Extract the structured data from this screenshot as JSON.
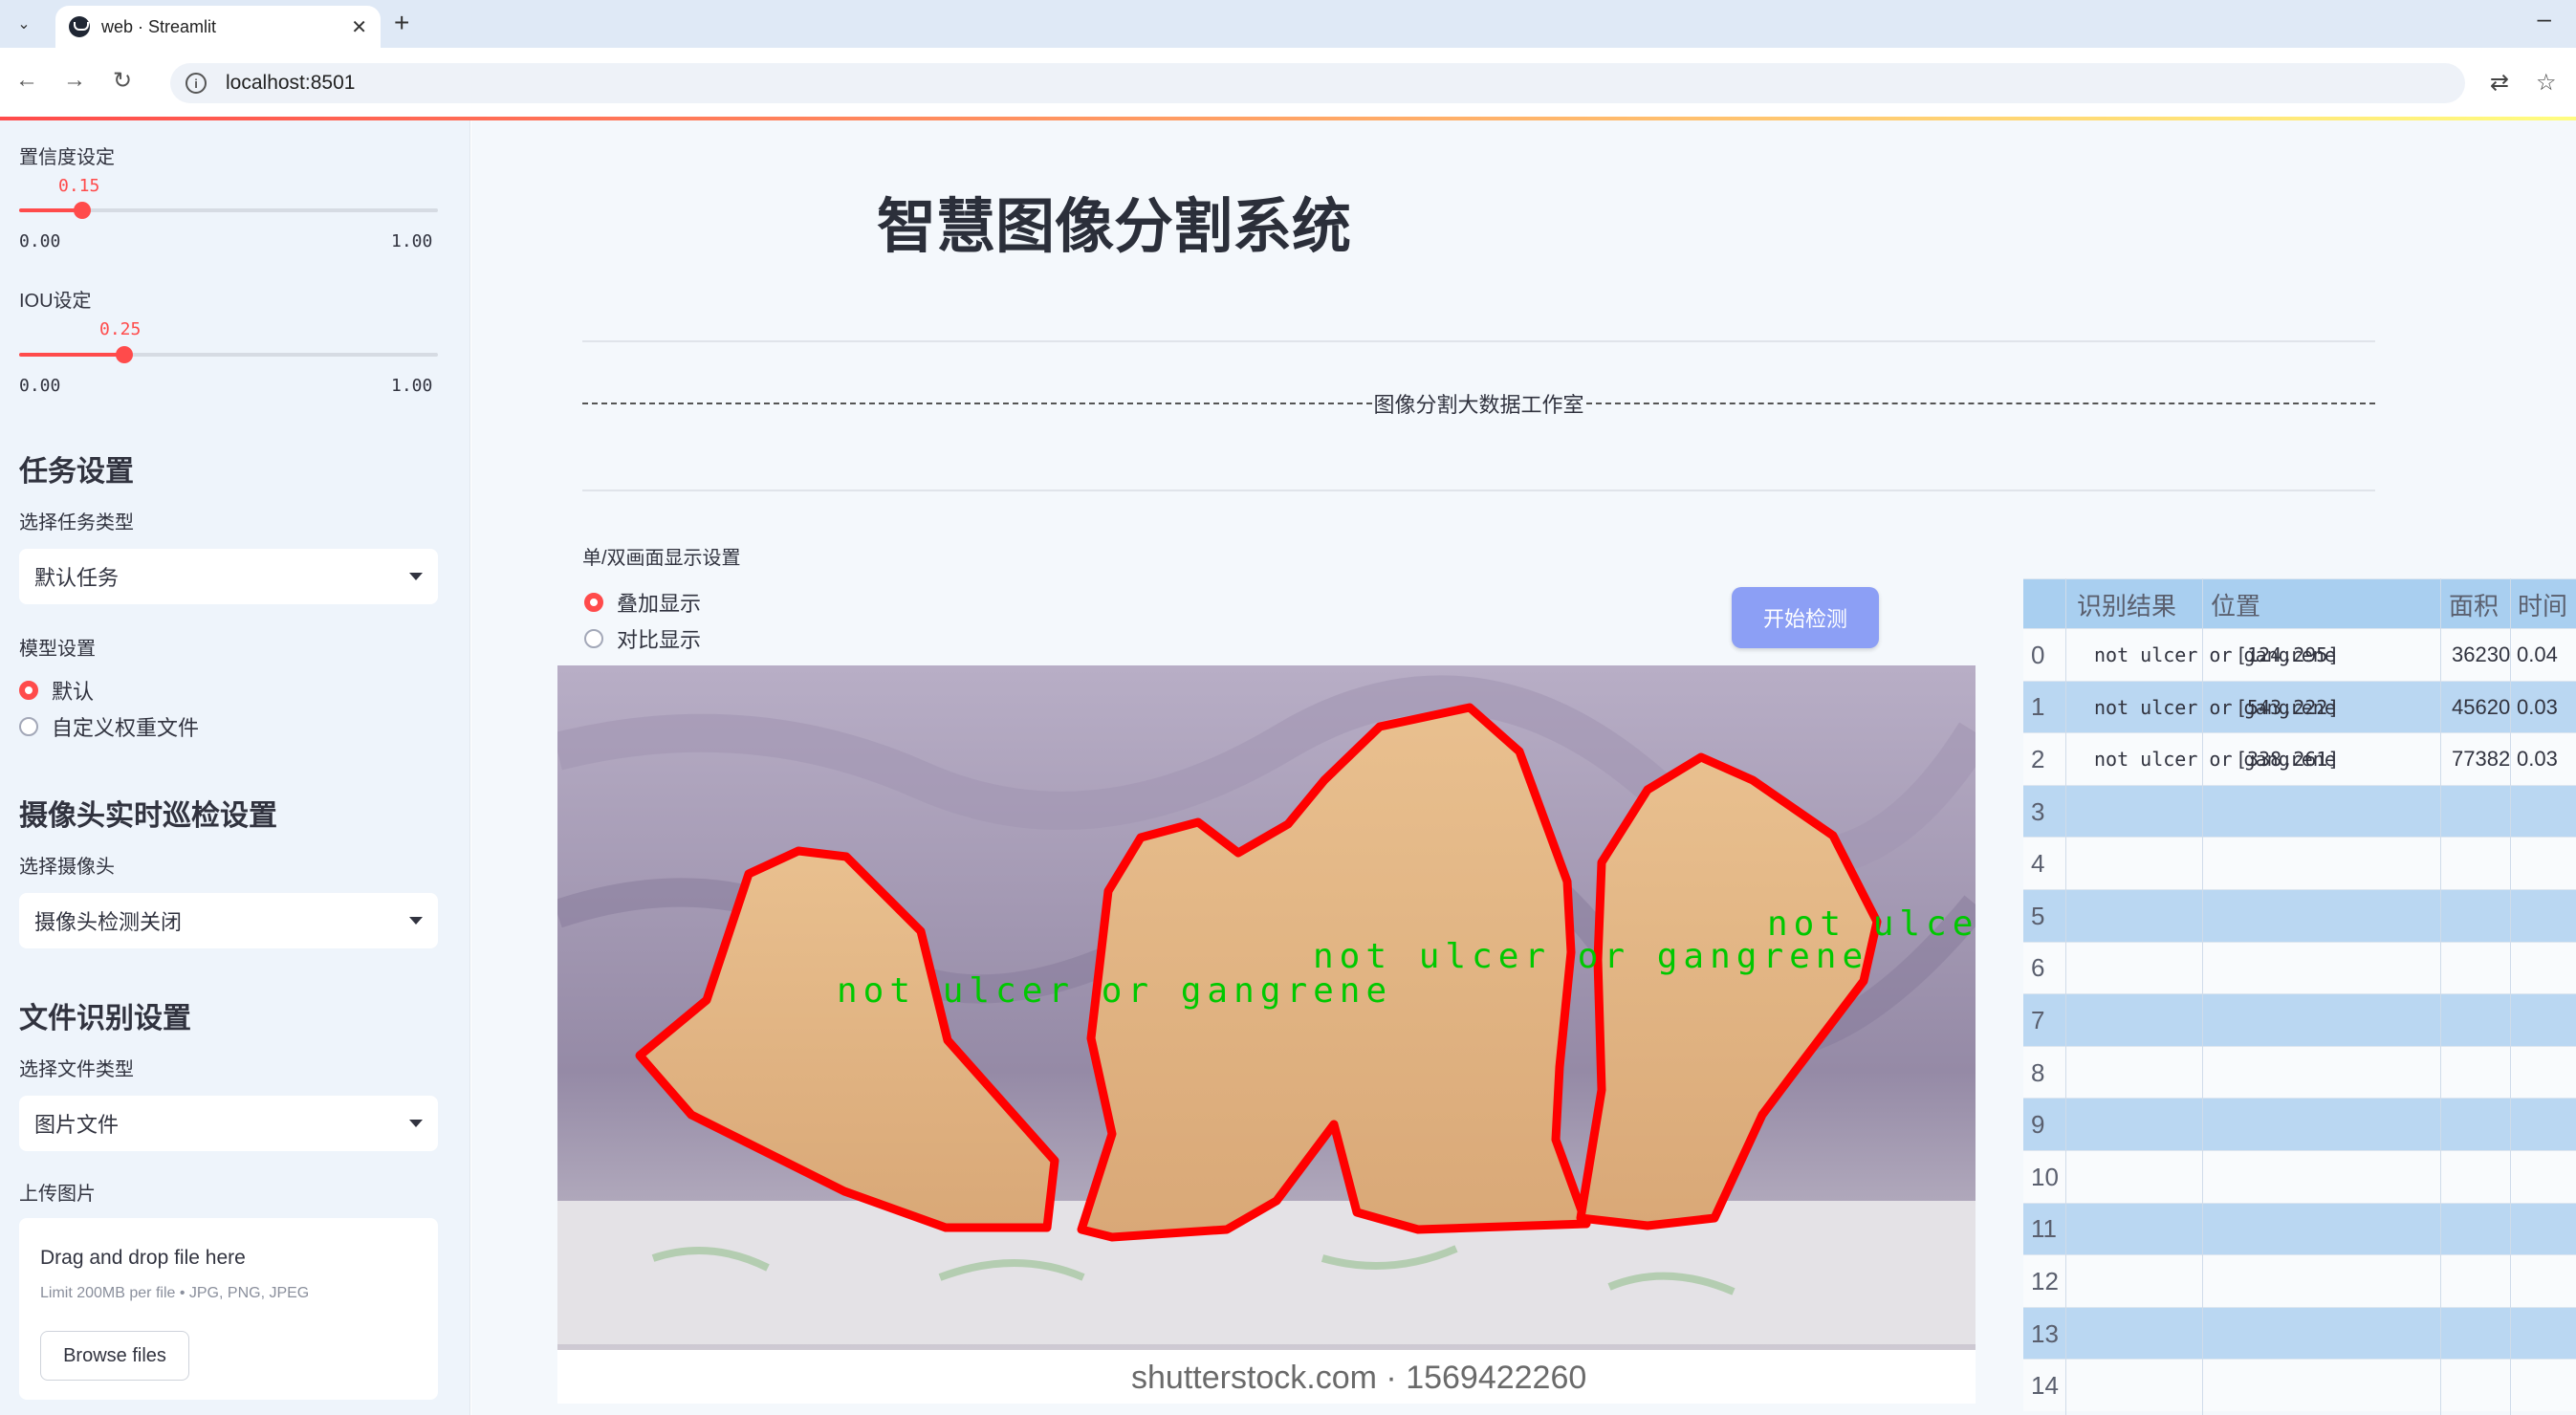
{
  "browser": {
    "tab_title": "web · Streamlit",
    "url": "localhost:8501"
  },
  "sidebar": {
    "confidence": {
      "label": "置信度设定",
      "value": "0.15",
      "min": "0.00",
      "max": "1.00",
      "fraction": 0.15
    },
    "iou": {
      "label": "IOU设定",
      "value": "0.25",
      "min": "0.00",
      "max": "1.00",
      "fraction": 0.25
    },
    "task_header": "任务设置",
    "task_type_label": "选择任务类型",
    "task_type_value": "默认任务",
    "model_label": "模型设置",
    "model_options": [
      "默认",
      "自定义权重文件"
    ],
    "model_selected": 0,
    "camera_header": "摄像头实时巡检设置",
    "camera_label": "选择摄像头",
    "camera_value": "摄像头检测关闭",
    "file_header": "文件识别设置",
    "file_type_label": "选择文件类型",
    "file_type_value": "图片文件",
    "upload_label": "上传图片",
    "upload_drag": "Drag and drop file here",
    "upload_limit": "Limit 200MB per file • JPG, PNG, JPEG",
    "upload_button": "Browse files"
  },
  "main": {
    "title": "智慧图像分割系统",
    "subtitle": "图像分割大数据工作室",
    "display_label": "单/双画面显示设置",
    "display_options": [
      "叠加显示",
      "对比显示"
    ],
    "display_selected": 0,
    "start_button": "开始检测",
    "detection_label": "not ulcer or gangrene",
    "watermark": "shutterstock.com · 1569422260"
  },
  "table": {
    "columns": [
      "",
      "识别结果",
      "位置",
      "面积",
      "时间"
    ],
    "rows": [
      {
        "idx": "0",
        "result": "not ulcer or gangrene",
        "position": "[124,295]",
        "area": "36230",
        "time": "0.04"
      },
      {
        "idx": "1",
        "result": "not ulcer or gangrene",
        "position": "[543,222]",
        "area": "45620",
        "time": "0.03"
      },
      {
        "idx": "2",
        "result": "not ulcer or gangrene",
        "position": "[338,261]",
        "area": "77382",
        "time": "0.03"
      },
      {
        "idx": "3"
      },
      {
        "idx": "4"
      },
      {
        "idx": "5"
      },
      {
        "idx": "6"
      },
      {
        "idx": "7"
      },
      {
        "idx": "8"
      },
      {
        "idx": "9"
      },
      {
        "idx": "10"
      },
      {
        "idx": "11"
      },
      {
        "idx": "12"
      },
      {
        "idx": "13"
      },
      {
        "idx": "14"
      }
    ]
  },
  "colors": {
    "accent": "#ff4b4b",
    "button": "#8c9ff5",
    "mask": "#ff0000",
    "label": "#00c800"
  }
}
